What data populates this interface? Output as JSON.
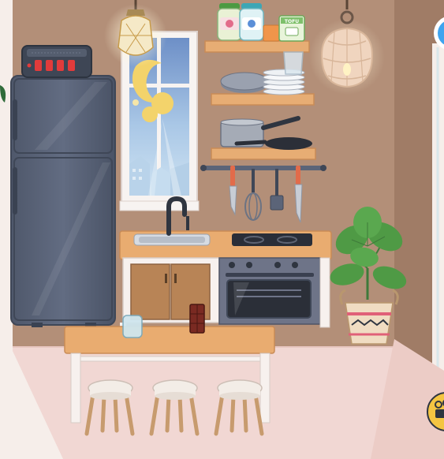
{
  "scene": {
    "room": "kitchen",
    "colors": {
      "wall": "#b38f78",
      "floor": "#f1d7d3",
      "wood": "#e5a86e",
      "fridge": "#5b6478",
      "oven": "#6e7488",
      "plant": "#4f9a45",
      "accent_yellow": "#f4c542",
      "accent_blue": "#3fa4ef"
    }
  },
  "shelf": {
    "jar_1_text": "",
    "jar_2_text": "",
    "box_text": "TOFU"
  },
  "hud": {
    "right_button_icon": "circle-button-icon",
    "corner_button_icon": "film-camera-icon"
  }
}
